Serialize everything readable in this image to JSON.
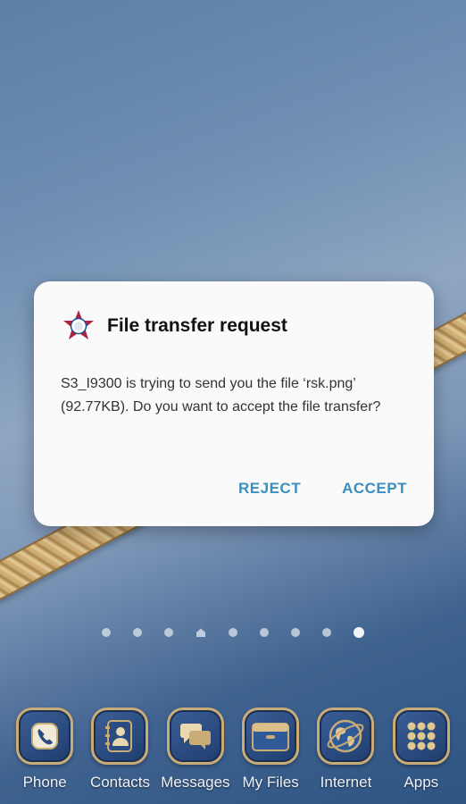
{
  "dialog": {
    "title": "File transfer request",
    "message": "S3_I9300 is trying to send you the file ‘rsk.png’ (92.77KB). Do you want to accept the file transfer?",
    "reject_label": "REJECT",
    "accept_label": "ACCEPT",
    "app_icon": "star-logo-icon"
  },
  "page_indicator": {
    "count": 9,
    "home_index": 3,
    "active_index": 8
  },
  "dock": {
    "items": [
      {
        "label": "Phone",
        "icon": "phone-icon"
      },
      {
        "label": "Contacts",
        "icon": "contacts-icon"
      },
      {
        "label": "Messages",
        "icon": "messages-icon"
      },
      {
        "label": "My Files",
        "icon": "folder-icon"
      },
      {
        "label": "Internet",
        "icon": "globe-icon"
      },
      {
        "label": "Apps",
        "icon": "apps-grid-icon"
      }
    ]
  },
  "colors": {
    "accent": "#3a8fbf",
    "gold": "#c9ab76",
    "icon_blue": "#2b4c80"
  }
}
